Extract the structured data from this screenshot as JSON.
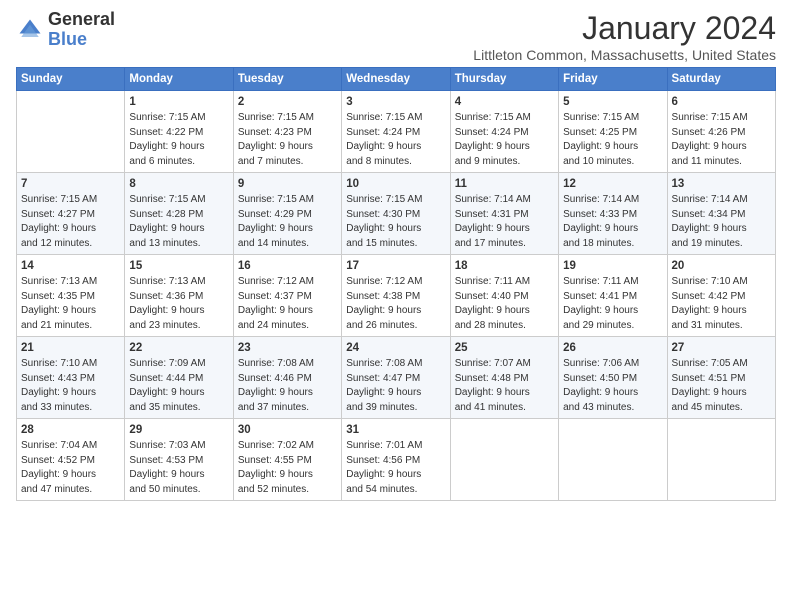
{
  "header": {
    "logo_line1": "General",
    "logo_line2": "Blue",
    "title": "January 2024",
    "subtitle": "Littleton Common, Massachusetts, United States"
  },
  "calendar": {
    "days_of_week": [
      "Sunday",
      "Monday",
      "Tuesday",
      "Wednesday",
      "Thursday",
      "Friday",
      "Saturday"
    ],
    "weeks": [
      [
        {
          "day": "",
          "info": ""
        },
        {
          "day": "1",
          "info": "Sunrise: 7:15 AM\nSunset: 4:22 PM\nDaylight: 9 hours\nand 6 minutes."
        },
        {
          "day": "2",
          "info": "Sunrise: 7:15 AM\nSunset: 4:23 PM\nDaylight: 9 hours\nand 7 minutes."
        },
        {
          "day": "3",
          "info": "Sunrise: 7:15 AM\nSunset: 4:24 PM\nDaylight: 9 hours\nand 8 minutes."
        },
        {
          "day": "4",
          "info": "Sunrise: 7:15 AM\nSunset: 4:24 PM\nDaylight: 9 hours\nand 9 minutes."
        },
        {
          "day": "5",
          "info": "Sunrise: 7:15 AM\nSunset: 4:25 PM\nDaylight: 9 hours\nand 10 minutes."
        },
        {
          "day": "6",
          "info": "Sunrise: 7:15 AM\nSunset: 4:26 PM\nDaylight: 9 hours\nand 11 minutes."
        }
      ],
      [
        {
          "day": "7",
          "info": "Sunrise: 7:15 AM\nSunset: 4:27 PM\nDaylight: 9 hours\nand 12 minutes."
        },
        {
          "day": "8",
          "info": "Sunrise: 7:15 AM\nSunset: 4:28 PM\nDaylight: 9 hours\nand 13 minutes."
        },
        {
          "day": "9",
          "info": "Sunrise: 7:15 AM\nSunset: 4:29 PM\nDaylight: 9 hours\nand 14 minutes."
        },
        {
          "day": "10",
          "info": "Sunrise: 7:15 AM\nSunset: 4:30 PM\nDaylight: 9 hours\nand 15 minutes."
        },
        {
          "day": "11",
          "info": "Sunrise: 7:14 AM\nSunset: 4:31 PM\nDaylight: 9 hours\nand 17 minutes."
        },
        {
          "day": "12",
          "info": "Sunrise: 7:14 AM\nSunset: 4:33 PM\nDaylight: 9 hours\nand 18 minutes."
        },
        {
          "day": "13",
          "info": "Sunrise: 7:14 AM\nSunset: 4:34 PM\nDaylight: 9 hours\nand 19 minutes."
        }
      ],
      [
        {
          "day": "14",
          "info": "Sunrise: 7:13 AM\nSunset: 4:35 PM\nDaylight: 9 hours\nand 21 minutes."
        },
        {
          "day": "15",
          "info": "Sunrise: 7:13 AM\nSunset: 4:36 PM\nDaylight: 9 hours\nand 23 minutes."
        },
        {
          "day": "16",
          "info": "Sunrise: 7:12 AM\nSunset: 4:37 PM\nDaylight: 9 hours\nand 24 minutes."
        },
        {
          "day": "17",
          "info": "Sunrise: 7:12 AM\nSunset: 4:38 PM\nDaylight: 9 hours\nand 26 minutes."
        },
        {
          "day": "18",
          "info": "Sunrise: 7:11 AM\nSunset: 4:40 PM\nDaylight: 9 hours\nand 28 minutes."
        },
        {
          "day": "19",
          "info": "Sunrise: 7:11 AM\nSunset: 4:41 PM\nDaylight: 9 hours\nand 29 minutes."
        },
        {
          "day": "20",
          "info": "Sunrise: 7:10 AM\nSunset: 4:42 PM\nDaylight: 9 hours\nand 31 minutes."
        }
      ],
      [
        {
          "day": "21",
          "info": "Sunrise: 7:10 AM\nSunset: 4:43 PM\nDaylight: 9 hours\nand 33 minutes."
        },
        {
          "day": "22",
          "info": "Sunrise: 7:09 AM\nSunset: 4:44 PM\nDaylight: 9 hours\nand 35 minutes."
        },
        {
          "day": "23",
          "info": "Sunrise: 7:08 AM\nSunset: 4:46 PM\nDaylight: 9 hours\nand 37 minutes."
        },
        {
          "day": "24",
          "info": "Sunrise: 7:08 AM\nSunset: 4:47 PM\nDaylight: 9 hours\nand 39 minutes."
        },
        {
          "day": "25",
          "info": "Sunrise: 7:07 AM\nSunset: 4:48 PM\nDaylight: 9 hours\nand 41 minutes."
        },
        {
          "day": "26",
          "info": "Sunrise: 7:06 AM\nSunset: 4:50 PM\nDaylight: 9 hours\nand 43 minutes."
        },
        {
          "day": "27",
          "info": "Sunrise: 7:05 AM\nSunset: 4:51 PM\nDaylight: 9 hours\nand 45 minutes."
        }
      ],
      [
        {
          "day": "28",
          "info": "Sunrise: 7:04 AM\nSunset: 4:52 PM\nDaylight: 9 hours\nand 47 minutes."
        },
        {
          "day": "29",
          "info": "Sunrise: 7:03 AM\nSunset: 4:53 PM\nDaylight: 9 hours\nand 50 minutes."
        },
        {
          "day": "30",
          "info": "Sunrise: 7:02 AM\nSunset: 4:55 PM\nDaylight: 9 hours\nand 52 minutes."
        },
        {
          "day": "31",
          "info": "Sunrise: 7:01 AM\nSunset: 4:56 PM\nDaylight: 9 hours\nand 54 minutes."
        },
        {
          "day": "",
          "info": ""
        },
        {
          "day": "",
          "info": ""
        },
        {
          "day": "",
          "info": ""
        }
      ]
    ]
  }
}
